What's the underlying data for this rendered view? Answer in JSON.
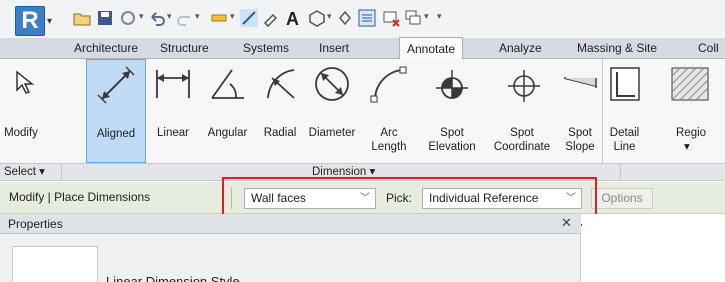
{
  "app": {
    "logo_letter": "R"
  },
  "tabs": [
    "Architecture",
    "Structure",
    "Systems",
    "Insert",
    "Annotate",
    "Analyze",
    "Massing & Site",
    "Coll"
  ],
  "active_tab": "Annotate",
  "tools": [
    {
      "label": "Modify",
      "label2": "",
      "icon": "cursor-arrow-icon",
      "selected": false
    },
    {
      "label": "Aligned",
      "label2": "",
      "icon": "aligned-dimension-icon",
      "selected": true
    },
    {
      "label": "Linear",
      "label2": "",
      "icon": "linear-dimension-icon",
      "selected": false
    },
    {
      "label": "Angular",
      "label2": "",
      "icon": "angular-dimension-icon",
      "selected": false
    },
    {
      "label": "Radial",
      "label2": "",
      "icon": "radial-dimension-icon",
      "selected": false
    },
    {
      "label": "Diameter",
      "label2": "",
      "icon": "diameter-dimension-icon",
      "selected": false
    },
    {
      "label": "Arc",
      "label2": "Length",
      "icon": "arc-length-icon",
      "selected": false
    },
    {
      "label": "Spot",
      "label2": "Elevation",
      "icon": "spot-elevation-icon",
      "selected": false
    },
    {
      "label": "Spot",
      "label2": "Coordinate",
      "icon": "spot-coordinate-icon",
      "selected": false
    },
    {
      "label": "Spot",
      "label2": "Slope",
      "icon": "spot-slope-icon",
      "selected": false
    },
    {
      "label": "Detail",
      "label2": "Line",
      "icon": "detail-line-icon",
      "selected": false
    },
    {
      "label": "Regio",
      "label2": "",
      "icon": "region-icon",
      "selected": false
    }
  ],
  "panels": {
    "select": "Select ▾",
    "dimension": "Dimension ▾"
  },
  "options_bar": {
    "context_title": "Modify | Place Dimensions",
    "reference": "Wall faces",
    "pick_label": "Pick:",
    "pick_value": "Individual Reference",
    "options_button": "Options"
  },
  "properties": {
    "title": "Properties",
    "close": "✕",
    "type_name": "Linear Dimension Style"
  },
  "colors": {
    "highlight": "#dd2020",
    "selected_tool": "#bfdbf6",
    "options_bar": "#e6eddf"
  }
}
